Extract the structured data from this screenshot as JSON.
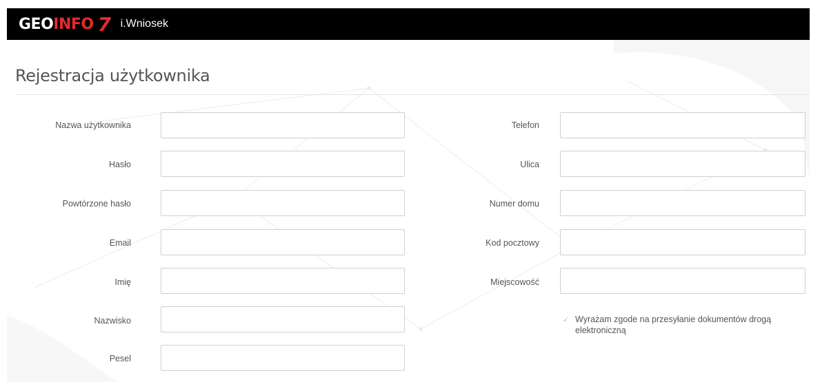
{
  "header": {
    "logo_geo": "GEO",
    "logo_info": "INFO",
    "logo_seven": "7",
    "app_name": "i.Wniosek"
  },
  "page": {
    "title": "Rejestracja użytkownika"
  },
  "form": {
    "left": [
      {
        "label": "Nazwa użytkownika",
        "value": ""
      },
      {
        "label": "Hasło",
        "value": ""
      },
      {
        "label": "Powtórzone hasło",
        "value": ""
      },
      {
        "label": "Email",
        "value": ""
      },
      {
        "label": "Imię",
        "value": ""
      },
      {
        "label": "Nazwisko",
        "value": ""
      },
      {
        "label": "Pesel",
        "value": ""
      }
    ],
    "right": [
      {
        "label": "Telefon",
        "value": ""
      },
      {
        "label": "Ulica",
        "value": ""
      },
      {
        "label": "Numer domu",
        "value": ""
      },
      {
        "label": "Kod pocztowy",
        "value": ""
      },
      {
        "label": "Miejscowość",
        "value": ""
      }
    ],
    "consent": {
      "checked": true,
      "text": "Wyrażam zgode na przesyłanie dokumentów drogą elektroniczną"
    }
  },
  "colors": {
    "header_bg": "#000000",
    "logo_accent": "#e32b2b",
    "text": "#555555",
    "field_border": "#cfcfcf"
  }
}
